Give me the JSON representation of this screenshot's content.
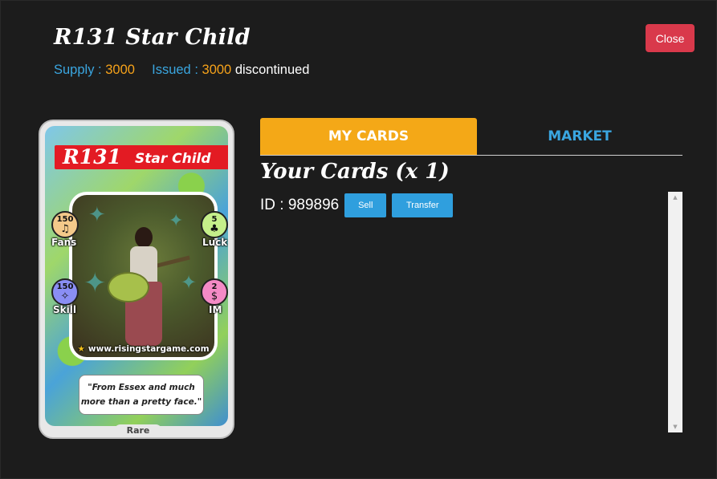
{
  "header": {
    "title": "R131 Star Child",
    "supply_label": "Supply :",
    "supply_value": "3000",
    "issued_label": "Issued :",
    "issued_value": "3000",
    "status": "discontinued",
    "close_label": "Close"
  },
  "card": {
    "id": "R131",
    "name": "Star Child",
    "stats": {
      "fans": {
        "value": "150",
        "label": "Fans"
      },
      "luck": {
        "value": "5",
        "label": "Luck"
      },
      "skill": {
        "value": "150",
        "label": "Skill"
      },
      "im": {
        "value": "2",
        "label": "IM"
      }
    },
    "website": "www.risingstargame.com",
    "quote_line1": "\"From Essex and much",
    "quote_line2": "more than a pretty face.\"",
    "rarity": "Rare"
  },
  "tabs": [
    {
      "label": "MY CARDS",
      "active": true
    },
    {
      "label": "MARKET",
      "active": false
    }
  ],
  "my_cards": {
    "heading": "Your Cards (x 1)",
    "items": [
      {
        "id_text": "ID : 989896",
        "sell_label": "Sell",
        "transfer_label": "Transfer"
      }
    ]
  },
  "colors": {
    "accent_orange": "#f4a817",
    "accent_blue": "#3aa6e0",
    "close_red": "#d9394b",
    "background": "#1c1c1c"
  }
}
